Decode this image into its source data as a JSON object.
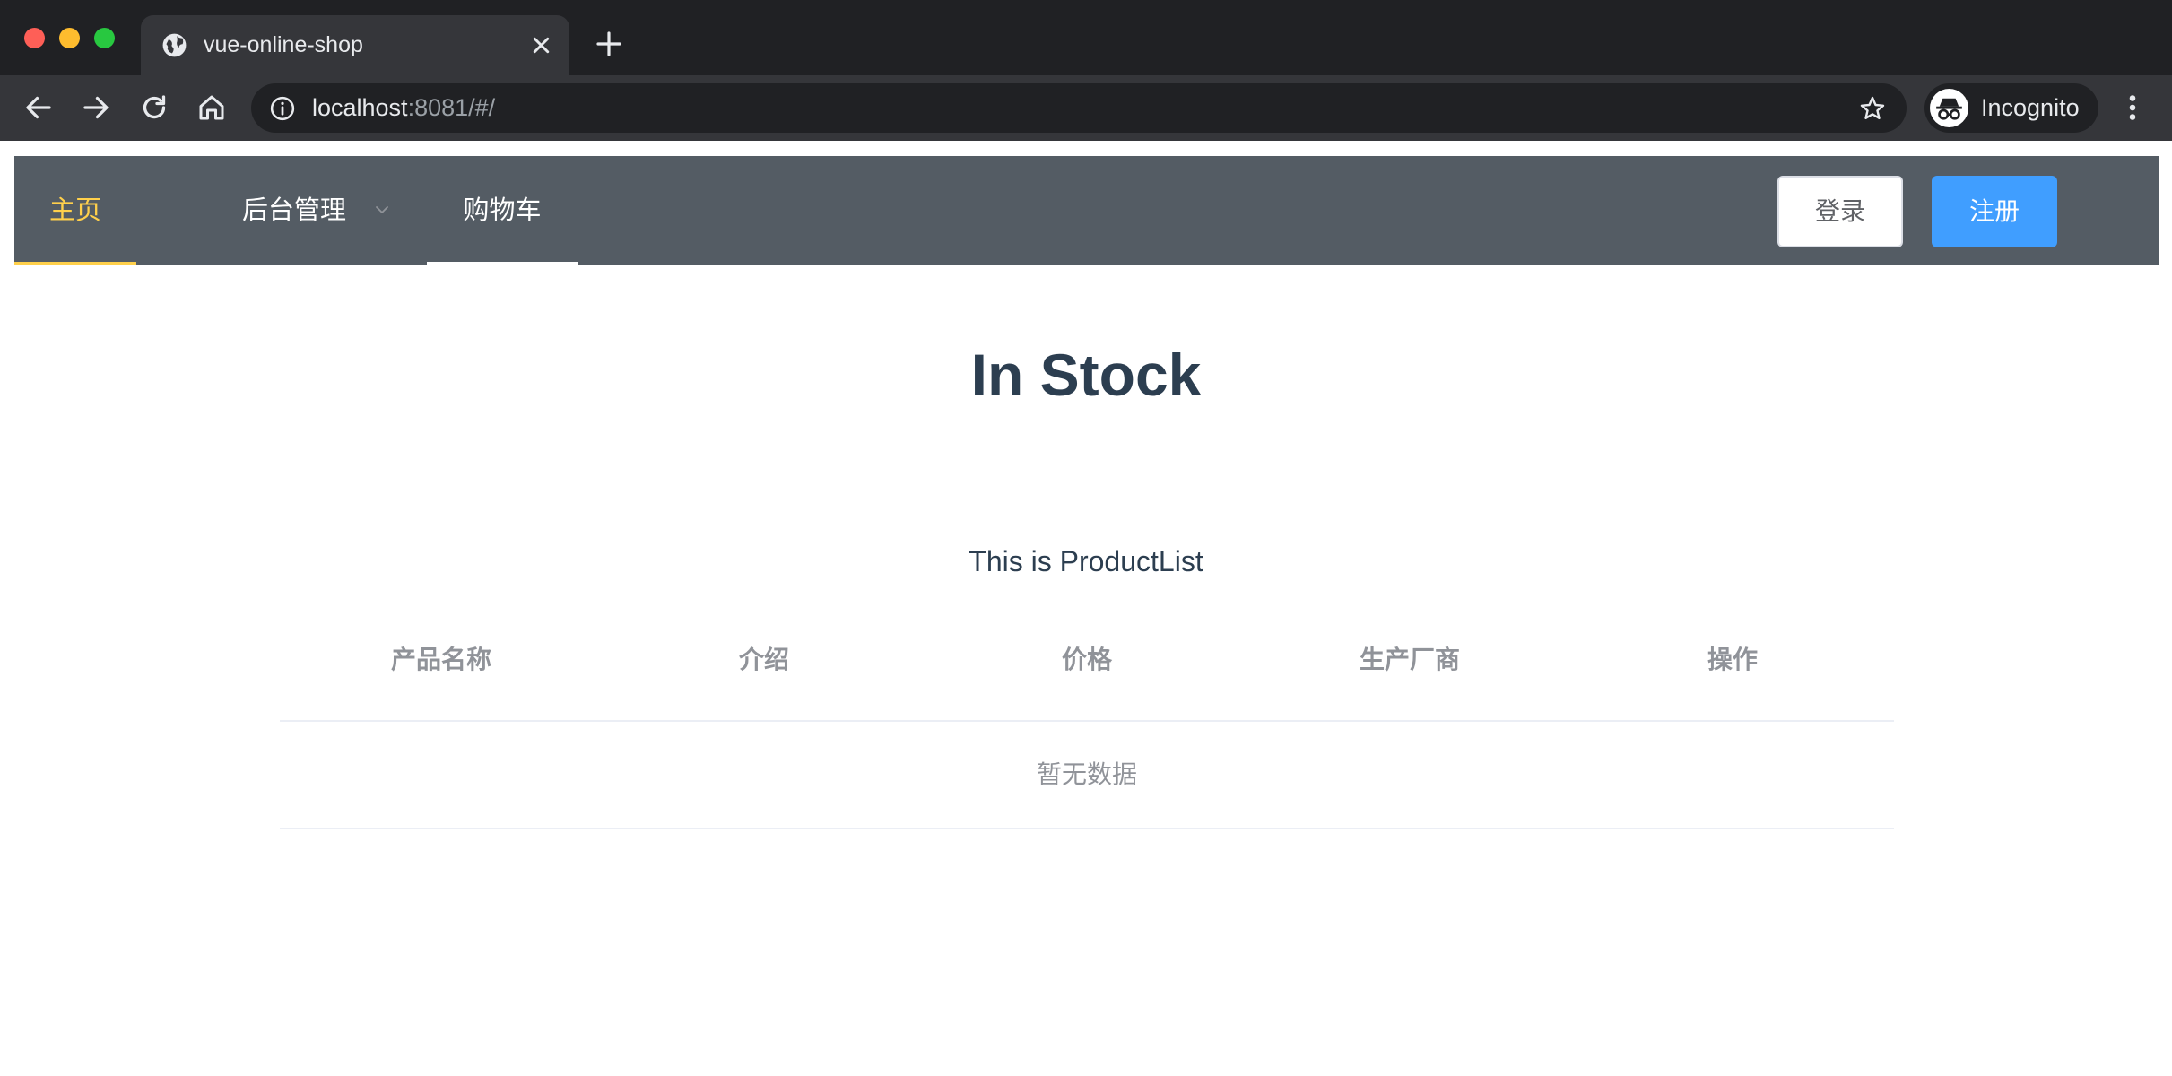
{
  "browser": {
    "tab_title": "vue-online-shop",
    "url_host": "localhost",
    "url_rest": ":8081/#/",
    "profile_label": "Incognito",
    "icons": [
      "globe-icon",
      "close-icon",
      "plus-icon",
      "back-arrow-icon",
      "forward-arrow-icon",
      "reload-icon",
      "home-icon",
      "info-icon",
      "star-icon",
      "incognito-icon",
      "kebab-menu-icon"
    ]
  },
  "nav": {
    "home": "主页",
    "admin": "后台管理",
    "cart": "购物车",
    "login": "登录",
    "register": "注册",
    "active_color": "#ffd04b",
    "bg_color": "#545c64"
  },
  "main": {
    "title": "In Stock",
    "subtitle": "This is ProductList",
    "table": {
      "headers": [
        "产品名称",
        "介绍",
        "价格",
        "生产厂商",
        "操作"
      ],
      "empty_text": "暂无数据"
    }
  },
  "colors": {
    "primary": "#409eff",
    "heading": "#2c3e50",
    "muted": "#909399"
  }
}
